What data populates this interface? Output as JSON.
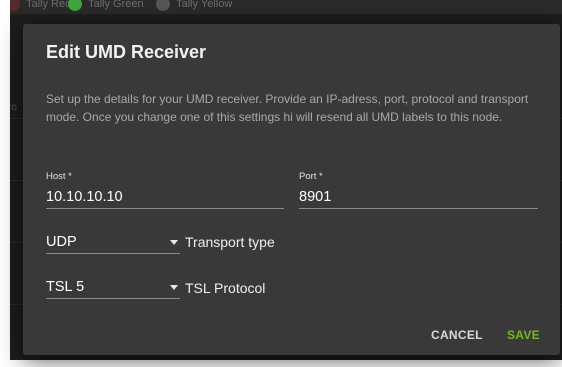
{
  "background": {
    "tallies": [
      {
        "label": "Tally Red",
        "color": "#5a2a2a"
      },
      {
        "label": "Tally Green",
        "color": "#3fa63f"
      },
      {
        "label": "Tally Yellow",
        "color": "#555555"
      }
    ],
    "edge_text": "ro"
  },
  "dialog": {
    "title": "Edit UMD Receiver",
    "description": "Set up the details for your UMD receiver. Provide an IP-adress, port, protocol and transport mode. Once you change one of this settings hi will resend all UMD labels to this node.",
    "host": {
      "label": "Host *",
      "value": "10.10.10.10"
    },
    "port": {
      "label": "Port *",
      "value": "8901"
    },
    "transport": {
      "selected": "UDP",
      "label": "Transport type",
      "icon": "caret-down-icon"
    },
    "protocol": {
      "selected": "TSL 5",
      "label": "TSL Protocol",
      "icon": "caret-down-icon"
    },
    "actions": {
      "cancel_label": "CANCEL",
      "save_label": "SAVE"
    }
  },
  "colors": {
    "dialog_bg": "#393939",
    "save": "#76b82a",
    "cancel": "#d9d9d9"
  }
}
